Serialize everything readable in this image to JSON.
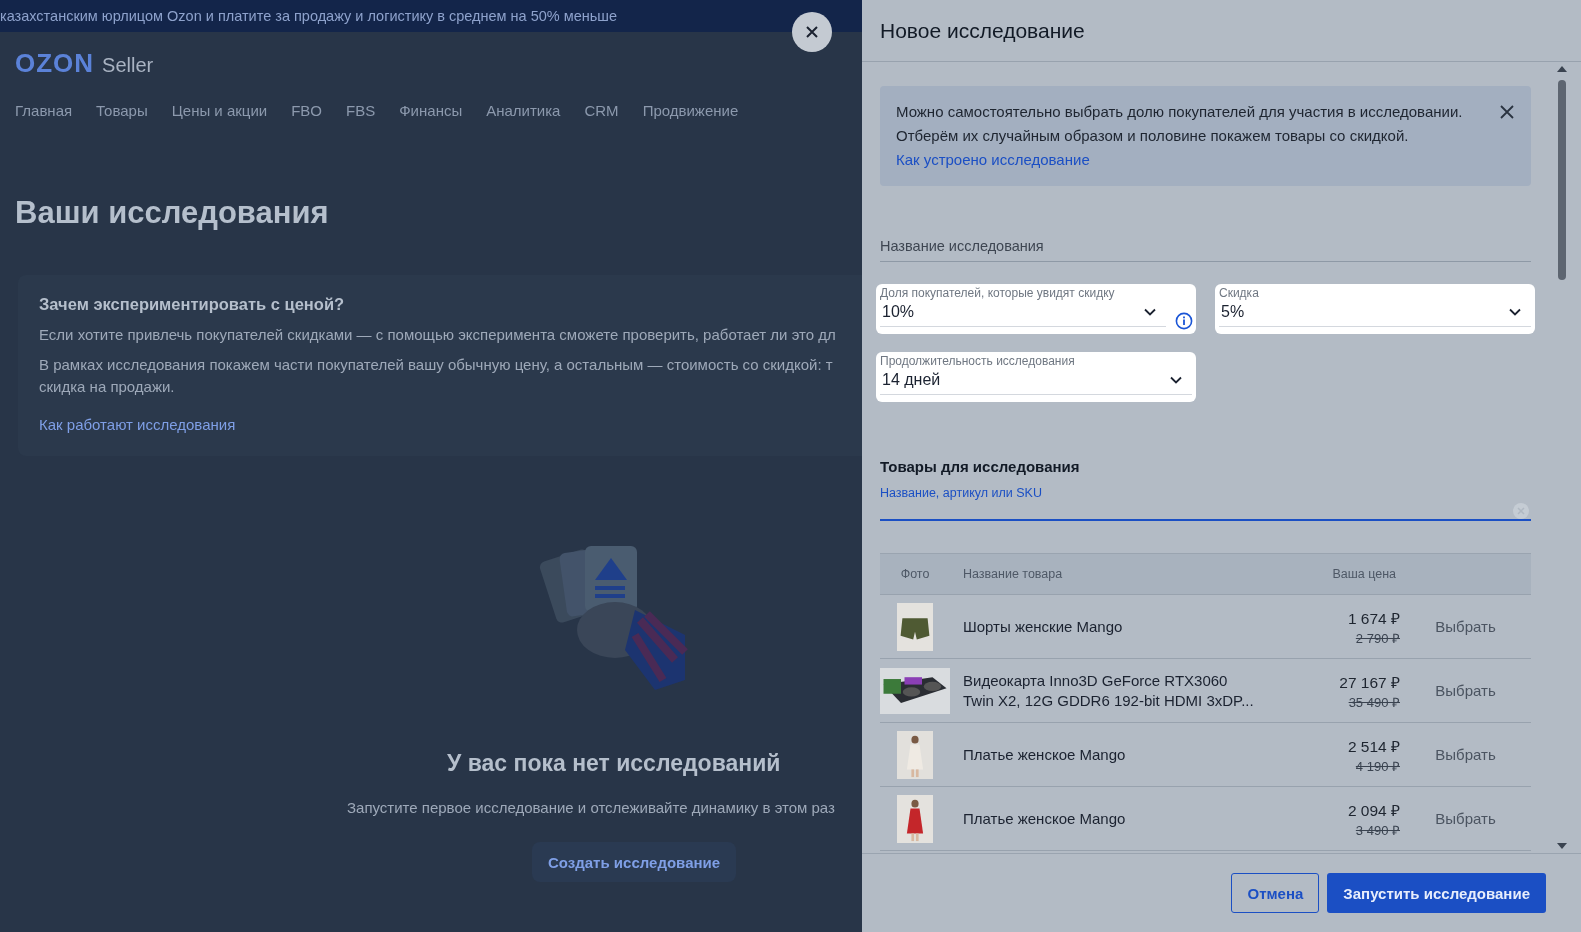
{
  "promo_banner": {
    "text": "казахстанским юрлицом Ozon и платите за продажу и логистику в среднем на 50% меньше"
  },
  "header": {
    "logo": "OZON",
    "logo_suffix": "Seller",
    "nav": [
      "Главная",
      "Товары",
      "Цены и акции",
      "FBO",
      "FBS",
      "Финансы",
      "Аналитика",
      "CRM",
      "Продвижение"
    ]
  },
  "page": {
    "title": "Ваши исследования",
    "info_card": {
      "title": "Зачем экспериментировать с ценой?",
      "paragraphs": [
        "Если хотите привлечь покупателей скидками — с помощью эксперимента сможете проверить, работает ли это дл",
        "В рамках исследования покажем части покупателей вашу обычную цену, а остальным — стоимость со скидкой: т",
        "скидка на продажи."
      ],
      "link": "Как работают исследования"
    },
    "empty_state": {
      "title": "У вас пока нет исследований",
      "text": "Запустите первое исследование и отслеживайте динамику в этом раз",
      "button": "Создать исследование"
    }
  },
  "drawer": {
    "title": "Новое исследование",
    "notice": {
      "text": "Можно самостоятельно выбрать долю покупателей для участия в исследовании. Отберём их случайным образом и половине покажем товары со скидкой.",
      "link": "Как устроено исследование"
    },
    "name_field": {
      "placeholder": "Название исследования"
    },
    "selects": [
      {
        "label": "Доля покупателей, которые увидят скидку",
        "value": "10%",
        "info": true
      },
      {
        "label": "Скидка",
        "value": "5%",
        "info": false
      },
      {
        "label": "Продолжительность исследования",
        "value": "14 дней",
        "info": false
      }
    ],
    "products": {
      "title": "Товары для исследования",
      "search": {
        "label": "Название, артикул или SKU"
      },
      "columns": [
        "Фото",
        "Название товара",
        "Ваша цена"
      ],
      "rows": [
        {
          "name": "Шорты женские Mango",
          "price": "1 674 ₽",
          "old_price": "2 790 ₽",
          "action": "Выбрать"
        },
        {
          "name": "Видеокарта Inno3D GeForce RTX3060 Twin X2, 12G GDDR6 192-bit HDMI 3xDP...",
          "price": "27 167 ₽",
          "old_price": "35 490 ₽",
          "action": "Выбрать"
        },
        {
          "name": "Платье женское Mango",
          "price": "2 514 ₽",
          "old_price": "4 190 ₽",
          "action": "Выбрать"
        },
        {
          "name": "Платье женское Mango",
          "price": "2 094 ₽",
          "old_price": "3 490 ₽",
          "action": "Выбрать"
        }
      ]
    },
    "buttons": {
      "cancel": "Отмена",
      "submit": "Запустить исследование"
    }
  }
}
